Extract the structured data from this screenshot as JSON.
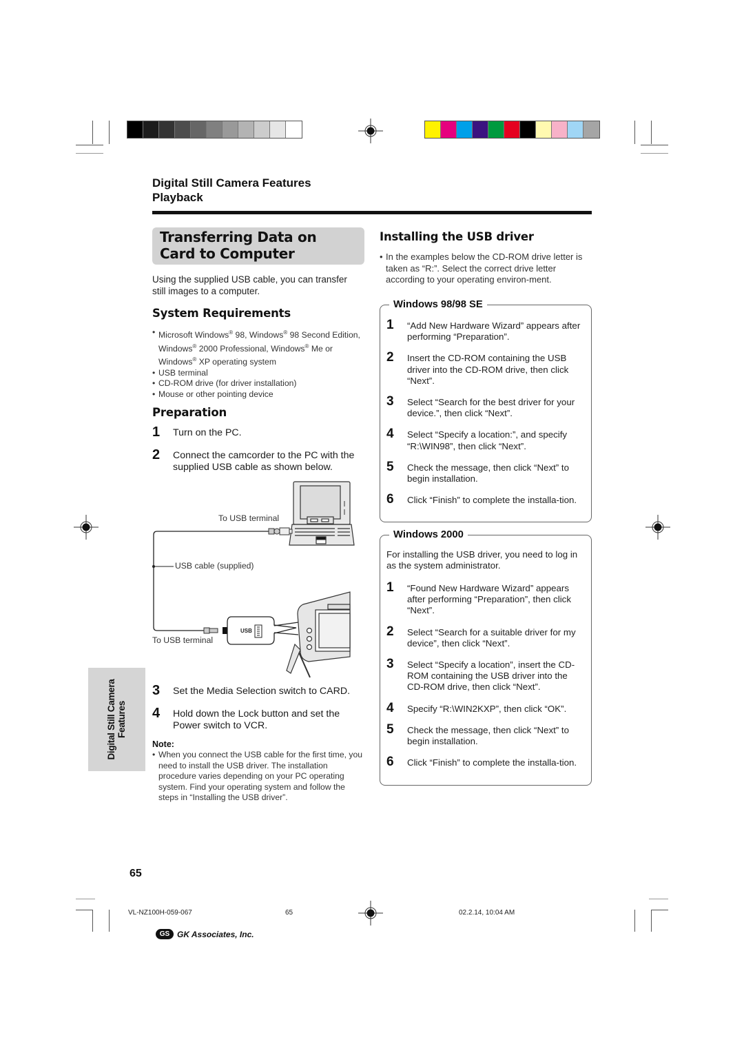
{
  "color_bars": {
    "grayscale": [
      "#000000",
      "#1c1c1c",
      "#333333",
      "#4d4d4d",
      "#666666",
      "#808080",
      "#999999",
      "#b3b3b3",
      "#cccccc",
      "#e6e6e6",
      "#ffffff"
    ],
    "process": [
      "#fff200",
      "#e6007e",
      "#00a0e9",
      "#3b1380",
      "#009a3e",
      "#e50020",
      "#000000",
      "#fff9b0",
      "#f7b2c8",
      "#a0d6f5",
      "#a5a5a5"
    ]
  },
  "header": {
    "section_line1": "Digital Still Camera Features",
    "section_line2": "Playback"
  },
  "title": {
    "line1": "Transferring Data on",
    "line2": "Card to Computer"
  },
  "intro": "Using the supplied USB cable, you can transfer still images to a computer.",
  "system_requirements": {
    "heading": "System Requirements",
    "items": [
      "Microsoft Windows® 98, Windows® 98 Second Edition, Windows® 2000 Professional, Windows® Me or Windows® XP operating system",
      "USB terminal",
      "CD-ROM drive (for driver installation)",
      "Mouse or other pointing device"
    ]
  },
  "preparation": {
    "heading": "Preparation",
    "steps": [
      {
        "num": "1",
        "text": "Turn on the PC."
      },
      {
        "num": "2",
        "text": "Connect the camcorder to the PC with the supplied USB cable as shown below."
      },
      {
        "num": "3",
        "text": "Set the Media Selection switch to CARD."
      },
      {
        "num": "4",
        "text": "Hold down the Lock button and set the Power switch to VCR."
      }
    ],
    "note_label": "Note:",
    "note_text": "When you connect the USB cable for the first time, you need to install the USB driver. The installation procedure varies depending on your PC operating system. Find your operating system and follow the steps in “Installing the USB driver”."
  },
  "diagram": {
    "label_pc_terminal": "To USB terminal",
    "label_cable": "USB cable (supplied)",
    "label_cam_terminal": "To USB terminal",
    "port_label": "USB"
  },
  "sidetab": {
    "line1": "Digital Still Camera",
    "line2": "Features"
  },
  "install": {
    "heading": "Installing the USB driver",
    "note": "In the examples below the CD-ROM drive letter is taken as “R:”. Select the correct drive letter according to your operating environ-ment.",
    "win98": {
      "label": "Windows 98/98 SE",
      "steps": [
        {
          "num": "1",
          "text": "“Add New Hardware Wizard” appears after performing “Preparation”."
        },
        {
          "num": "2",
          "text": "Insert the CD-ROM containing the USB driver into the CD-ROM drive, then click “Next”."
        },
        {
          "num": "3",
          "text": "Select “Search for the best driver for your device.”, then click “Next”."
        },
        {
          "num": "4",
          "text": "Select “Specify a location:”, and specify “R:\\WIN98”, then click “Next”."
        },
        {
          "num": "5",
          "text": "Check the message, then click “Next” to begin installation."
        },
        {
          "num": "6",
          "text": "Click “Finish” to complete the installa-tion."
        }
      ]
    },
    "win2000": {
      "label": "Windows 2000",
      "intro": "For installing the USB driver, you need to log in as the system administrator.",
      "steps": [
        {
          "num": "1",
          "text": "“Found New Hardware Wizard” appears after performing “Preparation”, then click “Next”."
        },
        {
          "num": "2",
          "text": "Select “Search for a suitable driver for my device”, then click “Next”."
        },
        {
          "num": "3",
          "text": "Select “Specify a location”, insert the CD-ROM containing the USB driver into the CD-ROM drive, then click “Next”."
        },
        {
          "num": "4",
          "text": "Specify “R:\\WIN2KXP”, then click “OK”."
        },
        {
          "num": "5",
          "text": "Check the message, then click “Next” to begin installation."
        },
        {
          "num": "6",
          "text": "Click “Finish” to complete the installa-tion."
        }
      ]
    }
  },
  "page_number": "65",
  "footer": {
    "file_code": "VL-NZ100H-059-067",
    "page": "65",
    "timestamp": "02.2.14, 10:04 AM",
    "company_logo": "GS",
    "company": "GK Associates, Inc."
  }
}
